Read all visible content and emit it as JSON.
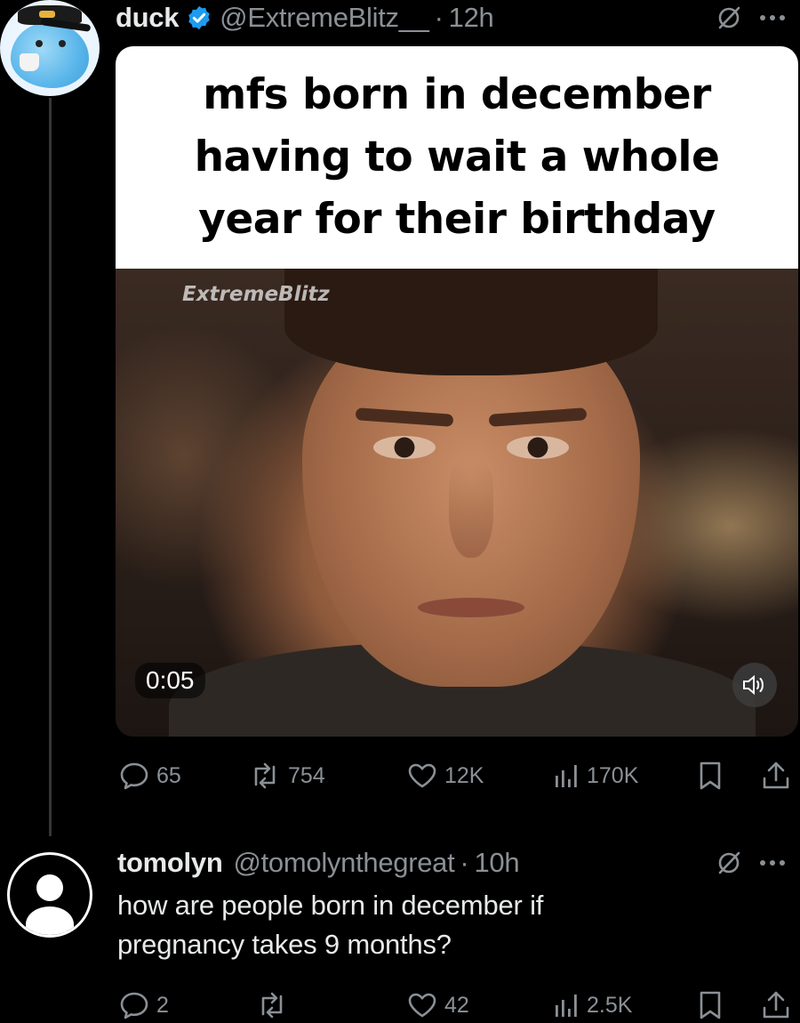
{
  "main_tweet": {
    "display_name": "duck",
    "handle": "@ExtremeBlitz__",
    "separator": "·",
    "time": "12h",
    "media": {
      "caption": "mfs born in december\nhaving to wait a whole\nyear for their birthday",
      "watermark": "ExtremeBlitz",
      "video_timestamp": "0:05"
    },
    "stats": {
      "replies": "65",
      "reposts": "754",
      "likes": "12K",
      "views": "170K"
    }
  },
  "reply_tweet": {
    "display_name": "tomolyn",
    "handle": "@tomolynthegreat",
    "separator": "·",
    "time": "10h",
    "text": "how are people born in december if\npregnancy takes 9 months?",
    "stats": {
      "replies": "2",
      "reposts": "",
      "likes": "42",
      "views": "2.5K"
    }
  },
  "colors": {
    "background": "#000000",
    "text_primary": "#e7e9ea",
    "text_secondary": "#8b9095",
    "verified_blue": "#1d9bf0"
  }
}
